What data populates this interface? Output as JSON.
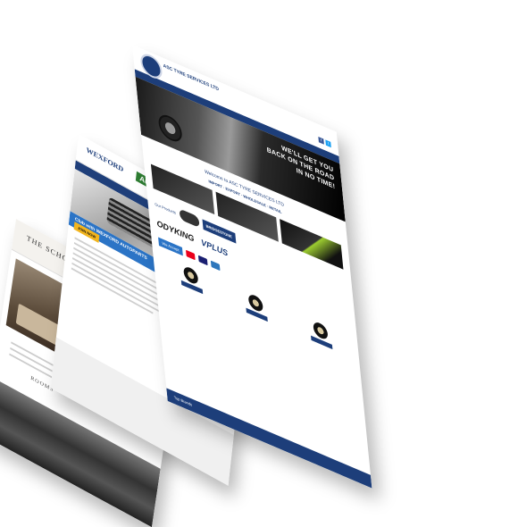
{
  "hotel": {
    "logo": "THE SCHOONER HOTEL",
    "rooms_label": "ROOMS"
  },
  "autoparts": {
    "brand_left": "WEXFORD",
    "brand_right": "Autoparts",
    "club_text": "Club with WEXFORD AUTOPARTS",
    "club_button": "JOIN NOW"
  },
  "asc": {
    "company": "ASC TYRE SERVICES LTD",
    "slogan_line1": "WE'LL GET YOU",
    "slogan_line2": "BACK ON THE ROAD",
    "slogan_line3": "IN NO TIME!",
    "welcome": "Welcome to ASC TYRE SERVICES LTD",
    "tags": "IMPORT · EXPORT · WHOLESALE · RETAIL",
    "featured_label": "Our Products",
    "featured_badge": "BRIDGESTONE",
    "brand1": "ODYKING",
    "brand2": "VPLUS",
    "payments_label": "We Accept",
    "bottom_text": "Top Brands",
    "colors": {
      "primary": "#1d3e7a",
      "accent": "#2b74c6",
      "club_yellow": "#f2b51f"
    }
  }
}
